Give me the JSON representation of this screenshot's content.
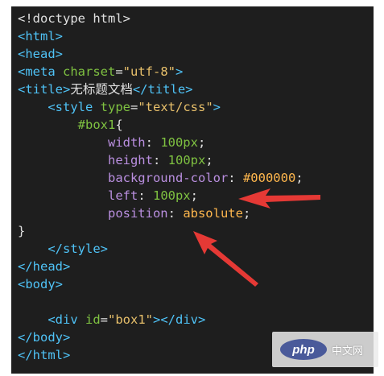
{
  "code_lines": [
    [
      {
        "t": "<!doctype html>",
        "c": "tk-plain"
      }
    ],
    [
      {
        "t": "<html>",
        "c": "tk-tag"
      }
    ],
    [
      {
        "t": "<head>",
        "c": "tk-tag"
      }
    ],
    [
      {
        "t": "<meta ",
        "c": "tk-tag"
      },
      {
        "t": "charset",
        "c": "tk-attr"
      },
      {
        "t": "=",
        "c": "tk-plain"
      },
      {
        "t": "\"utf-8\"",
        "c": "tk-str"
      },
      {
        "t": ">",
        "c": "tk-tag"
      }
    ],
    [
      {
        "t": "<title>",
        "c": "tk-tag"
      },
      {
        "t": "无标题文档",
        "c": "tk-plain"
      },
      {
        "t": "</title>",
        "c": "tk-tag"
      }
    ],
    [
      {
        "t": "    <style ",
        "c": "tk-tag"
      },
      {
        "t": "type",
        "c": "tk-attr"
      },
      {
        "t": "=",
        "c": "tk-plain"
      },
      {
        "t": "\"text/css\"",
        "c": "tk-str"
      },
      {
        "t": ">",
        "c": "tk-tag"
      }
    ],
    [
      {
        "t": "        #box1",
        "c": "tk-sel"
      },
      {
        "t": "{",
        "c": "tk-plain"
      }
    ],
    [
      {
        "t": "            width",
        "c": "tk-prop"
      },
      {
        "t": ": ",
        "c": "tk-plain"
      },
      {
        "t": "100px",
        "c": "tk-num"
      },
      {
        "t": ";",
        "c": "tk-plain"
      }
    ],
    [
      {
        "t": "            height",
        "c": "tk-prop"
      },
      {
        "t": ": ",
        "c": "tk-plain"
      },
      {
        "t": "100px",
        "c": "tk-num"
      },
      {
        "t": ";",
        "c": "tk-plain"
      }
    ],
    [
      {
        "t": "            background-color",
        "c": "tk-prop"
      },
      {
        "t": ": ",
        "c": "tk-plain"
      },
      {
        "t": "#000000",
        "c": "tk-val"
      },
      {
        "t": ";",
        "c": "tk-plain"
      }
    ],
    [
      {
        "t": "            left",
        "c": "tk-prop"
      },
      {
        "t": ": ",
        "c": "tk-plain"
      },
      {
        "t": "100px",
        "c": "tk-num"
      },
      {
        "t": ";",
        "c": "tk-plain"
      }
    ],
    [
      {
        "t": "            position",
        "c": "tk-prop"
      },
      {
        "t": ": ",
        "c": "tk-plain"
      },
      {
        "t": "absolute",
        "c": "tk-val"
      },
      {
        "t": ";",
        "c": "tk-plain"
      }
    ],
    [
      {
        "t": "}",
        "c": "tk-plain"
      }
    ],
    [
      {
        "t": "    </style>",
        "c": "tk-tag"
      }
    ],
    [
      {
        "t": "</head>",
        "c": "tk-tag"
      }
    ],
    [
      {
        "t": "<body>",
        "c": "tk-tag"
      }
    ],
    [
      {
        "t": "",
        "c": "tk-plain"
      }
    ],
    [
      {
        "t": "    <div ",
        "c": "tk-tag"
      },
      {
        "t": "id",
        "c": "tk-attr"
      },
      {
        "t": "=",
        "c": "tk-plain"
      },
      {
        "t": "\"box1\"",
        "c": "tk-str"
      },
      {
        "t": "></div>",
        "c": "tk-tag"
      }
    ],
    [
      {
        "t": "</body>",
        "c": "tk-tag"
      }
    ],
    [
      {
        "t": "</html>",
        "c": "tk-tag"
      }
    ]
  ],
  "colors": {
    "editor_bg": "#1e1e1e",
    "tag": "#4fc3f7",
    "attr": "#7fc241",
    "string": "#e8c06b",
    "property": "#ba8fe0",
    "number": "#7fc241",
    "value": "#ffb74d",
    "arrow": "#e53935"
  },
  "annotations": {
    "arrow_1_icon": "red-arrow-icon",
    "arrow_2_icon": "red-arrow-icon"
  },
  "watermark": {
    "logo_text": "php",
    "site_text": "中文网"
  }
}
